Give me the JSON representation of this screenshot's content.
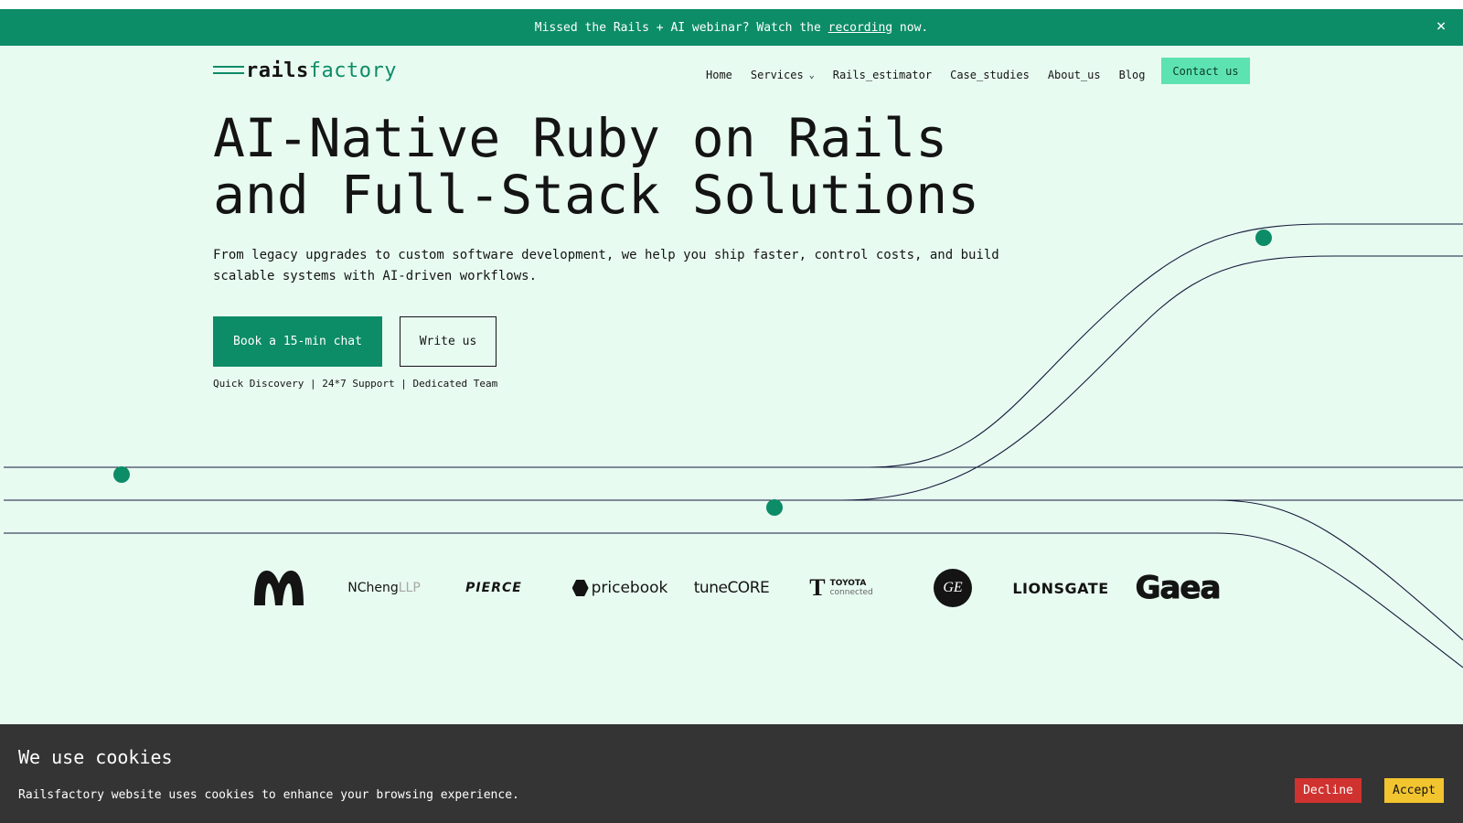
{
  "announcement": {
    "text_before": "Missed the Rails + AI webinar? Watch the ",
    "link": "recording",
    "text_after": " now.",
    "close_icon": "×"
  },
  "header": {
    "logo_part1": "rails",
    "logo_part2": "factory",
    "nav": [
      "Home",
      "Services",
      "Rails_estimator",
      "Case_studies",
      "About_us",
      "Blog"
    ],
    "contact": "Contact us"
  },
  "hero": {
    "title_line1": "AI-Native Ruby on Rails",
    "title_line2": "and Full-Stack Solutions",
    "subtitle": "From legacy upgrades to custom software development, we help you ship faster, control costs, and build scalable systems with AI-driven workflows.",
    "cta_primary": "Book a 15-min chat",
    "cta_secondary": "Write us",
    "features": "Quick Discovery | 24*7 Support | Dedicated Team"
  },
  "clients": {
    "ncheng": "NCheng",
    "ncheng_suffix": "LLP",
    "pierce": "PIERCE",
    "pricebook": "pricebook",
    "tunecore_part1": "tune",
    "tunecore_part2": "CORE",
    "toyota_line1": "TOYOTA",
    "toyota_line2": "connected",
    "lionsgate": "LIONSGATE",
    "gaea": "Gaea"
  },
  "cookie": {
    "title": "We use cookies",
    "text": "Railsfactory website uses cookies to enhance your browsing experience.",
    "decline": "Decline",
    "accept": "Accept"
  },
  "colors": {
    "brand_green": "#0c8c67",
    "background": "#e8fbf1",
    "contact_button": "#5de3b1",
    "decline": "#d0322f",
    "accept": "#f2c42f"
  }
}
